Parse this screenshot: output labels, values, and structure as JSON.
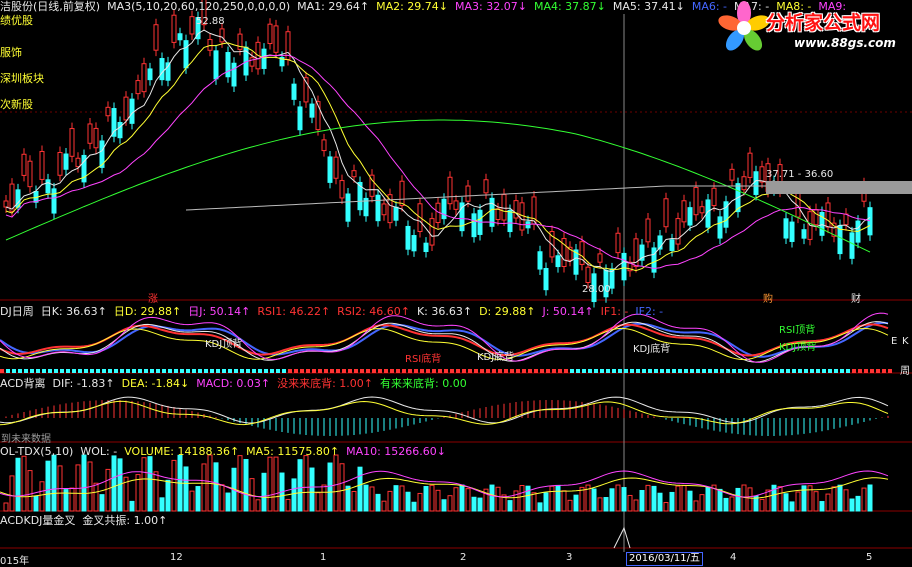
{
  "header": {
    "title": "洁股份(日线,前复权)",
    "items": [
      {
        "text": "MA3(5,10,20,60,120,250,0,0,0,0)",
        "color": "#e8e8e8"
      },
      {
        "text": "MA1: 29.64↑",
        "color": "#e8e8e8"
      },
      {
        "text": "MA2: 29.74↓",
        "color": "#ffff33"
      },
      {
        "text": "MA3: 32.07↓",
        "color": "#ff44ff"
      },
      {
        "text": "MA4: 37.87↓",
        "color": "#33ff33"
      },
      {
        "text": "MA5: 37.41↓",
        "color": "#e8e8e8"
      },
      {
        "text": "MA6: -",
        "color": "#4466ff"
      },
      {
        "text": "MA7: -",
        "color": "#e8e8e8"
      },
      {
        "text": "MA8: -",
        "color": "#ffff33"
      },
      {
        "text": "MA9:",
        "color": "#ff44ff"
      }
    ]
  },
  "blocks": [
    "绩优股",
    "服饰",
    "深圳板块",
    "次新股"
  ],
  "logo": {
    "title": "分析家公式网",
    "url": "www.88gs.com"
  },
  "price_labels": {
    "high": "52.88",
    "low": "28.00",
    "range": "37.71 - 36.60"
  },
  "badges": {
    "zhang": "涨",
    "ben": "购",
    "cai": "财"
  },
  "kdj_panel": {
    "items": [
      {
        "text": "DJ日周",
        "color": "#e8e8e8"
      },
      {
        "text": "日K: 36.63↑",
        "color": "#e8e8e8"
      },
      {
        "text": "日D: 29.88↑",
        "color": "#ffff33"
      },
      {
        "text": "日J: 50.14↑",
        "color": "#ff44ff"
      },
      {
        "text": "RSI1: 46.22↑",
        "color": "#ff3333"
      },
      {
        "text": "RSI2: 46.60↑",
        "color": "#ff3333"
      },
      {
        "text": "K: 36.63↑",
        "color": "#e8e8e8"
      },
      {
        "text": "D: 29.88↑",
        "color": "#ffff33"
      },
      {
        "text": "J: 50.14↑",
        "color": "#ff44ff"
      },
      {
        "text": "IF1: -",
        "color": "#ff3333"
      },
      {
        "text": "IF2: -",
        "color": "#4466ff"
      }
    ],
    "annotations": [
      "KDJ顶背",
      "RSI底背",
      "KDJ底背",
      "KDJ底背",
      "RSI顶背",
      "KDJ顶背"
    ],
    "side_labels": [
      "E",
      "K",
      "周"
    ]
  },
  "macd_panel": {
    "items": [
      {
        "text": "ACD背离",
        "color": "#e8e8e8"
      },
      {
        "text": "DIF: -1.83↑",
        "color": "#e8e8e8"
      },
      {
        "text": "DEA: -1.84↓",
        "color": "#ffff33"
      },
      {
        "text": "MACD: 0.03↑",
        "color": "#ff44ff"
      },
      {
        "text": "没来来底背: 1.00↑",
        "color": "#ff3333"
      },
      {
        "text": "有来来底背: 0.00",
        "color": "#33ff33"
      }
    ],
    "note": "到未来数据"
  },
  "vol_panel": {
    "items": [
      {
        "text": "OL-TDX(5,10)",
        "color": "#e8e8e8"
      },
      {
        "text": "WOL: -",
        "color": "#e8e8e8"
      },
      {
        "text": "VOLUME: 14188.36↑",
        "color": "#ffff33"
      },
      {
        "text": "MA5: 11575.80↑",
        "color": "#ffff33"
      },
      {
        "text": "MA10: 15266.60↓",
        "color": "#ff44ff"
      }
    ]
  },
  "signal_panel": {
    "items": [
      {
        "text": "ACDKDJ量金叉",
        "color": "#e8e8e8"
      },
      {
        "text": "金叉共振: 1.00↑",
        "color": "#e8e8e8"
      }
    ]
  },
  "xaxis": {
    "labels": [
      "015年",
      "12",
      "1",
      "2",
      "3",
      "4",
      "5"
    ],
    "cursor_date": "2016/03/11/五"
  }
}
